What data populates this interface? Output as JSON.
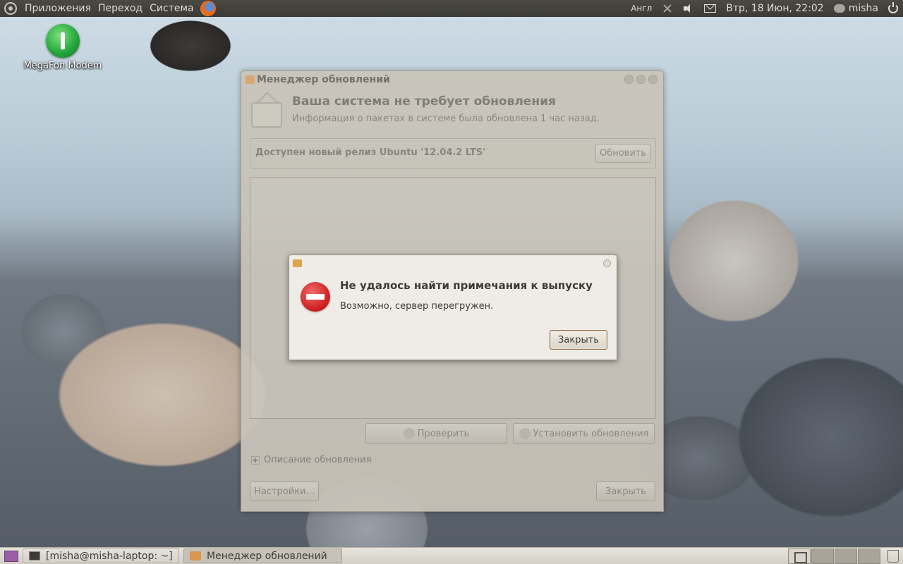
{
  "top_panel": {
    "menus": [
      "Приложения",
      "Переход",
      "Система"
    ],
    "keyboard_layout": "Англ",
    "datetime": "Втр, 18 Июн, 22:02",
    "user": "misha"
  },
  "desktop": {
    "icons": [
      {
        "label": "MegaFon Modem",
        "icon": "modem-icon"
      }
    ]
  },
  "update_manager": {
    "title": "Менеджер обновлений",
    "heading": "Ваша система не требует обновления",
    "subheading": "Информация о пакетах в системе была обновлена 1 час назад.",
    "release_text": "Доступен новый релиз Ubuntu '12.04.2 LTS'",
    "upgrade_button": "Обновить",
    "check_button": "Проверить",
    "install_button": "Установить обновления",
    "description_expander": "Описание обновления",
    "settings_button": "Настройки...",
    "close_button": "Закрыть"
  },
  "error_dialog": {
    "heading": "Не удалось найти примечания к выпуску",
    "message": "Возможно, сервер перегружен.",
    "close_button": "Закрыть",
    "icon": "error-icon"
  },
  "taskbar": {
    "tasks": [
      {
        "label": "[misha@misha-laptop: ~]",
        "icon": "terminal-icon",
        "active": false
      },
      {
        "label": "Менеджер обновлений",
        "icon": "update-manager-icon",
        "active": true
      }
    ],
    "workspaces": 4
  },
  "colors": {
    "panel_dark": "#3c3b37",
    "window_bg": "#c9c4b9",
    "dialog_bg": "#efece7",
    "error_red": "#cc1b1b"
  }
}
